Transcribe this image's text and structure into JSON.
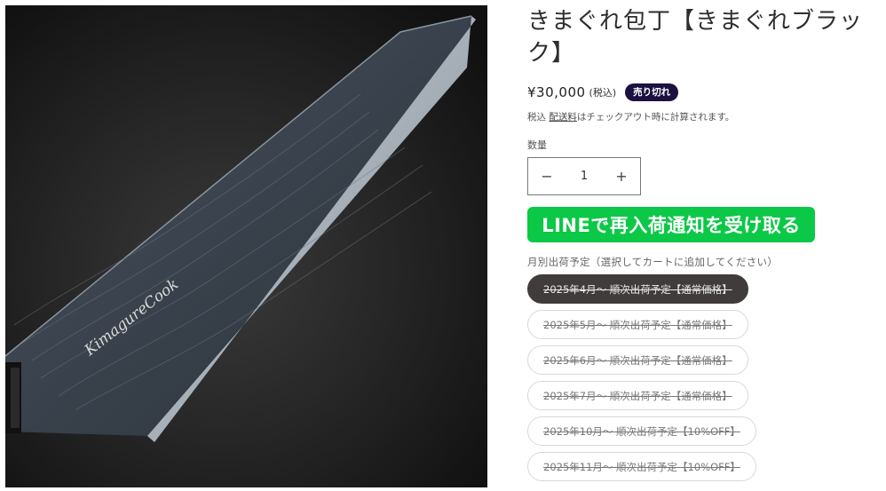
{
  "product": {
    "title": "きまぐれ包丁【きまぐれブラック】",
    "title_line1": "きまぐれ包丁【きまぐれブラッ",
    "title_line2": "ク】",
    "price": "¥30,000",
    "tax_inclusive": "(税込)",
    "sold_out_badge": "売り切れ",
    "shipping_prefix": "税込 ",
    "shipping_link": "配送料",
    "shipping_suffix": "はチェックアウト時に計算されます。",
    "image_signature": "KimagureCook"
  },
  "quantity": {
    "label": "数量",
    "value": "1",
    "decrement_symbol": "−",
    "increment_symbol": "+"
  },
  "line_button": {
    "label": "LINEで再入荷通知を受け取る"
  },
  "variants": {
    "label": "月別出荷予定（選択してカートに追加してください）",
    "options": [
      {
        "label": "2025年4月〜 順次出荷予定【通常価格】",
        "selected": true
      },
      {
        "label": "2025年5月〜 順次出荷予定【通常価格】",
        "selected": false
      },
      {
        "label": "2025年6月〜 順次出荷予定【通常価格】",
        "selected": false
      },
      {
        "label": "2025年7月〜 順次出荷予定【通常価格】",
        "selected": false
      },
      {
        "label": "2025年10月〜 順次出荷予定【10%OFF】",
        "selected": false
      },
      {
        "label": "2025年11月〜 順次出荷予定【10%OFF】",
        "selected": false
      }
    ]
  },
  "colors": {
    "line_green": "#0cc847",
    "badge_bg": "#1c1040",
    "selected_pill_bg": "#403c3c"
  }
}
